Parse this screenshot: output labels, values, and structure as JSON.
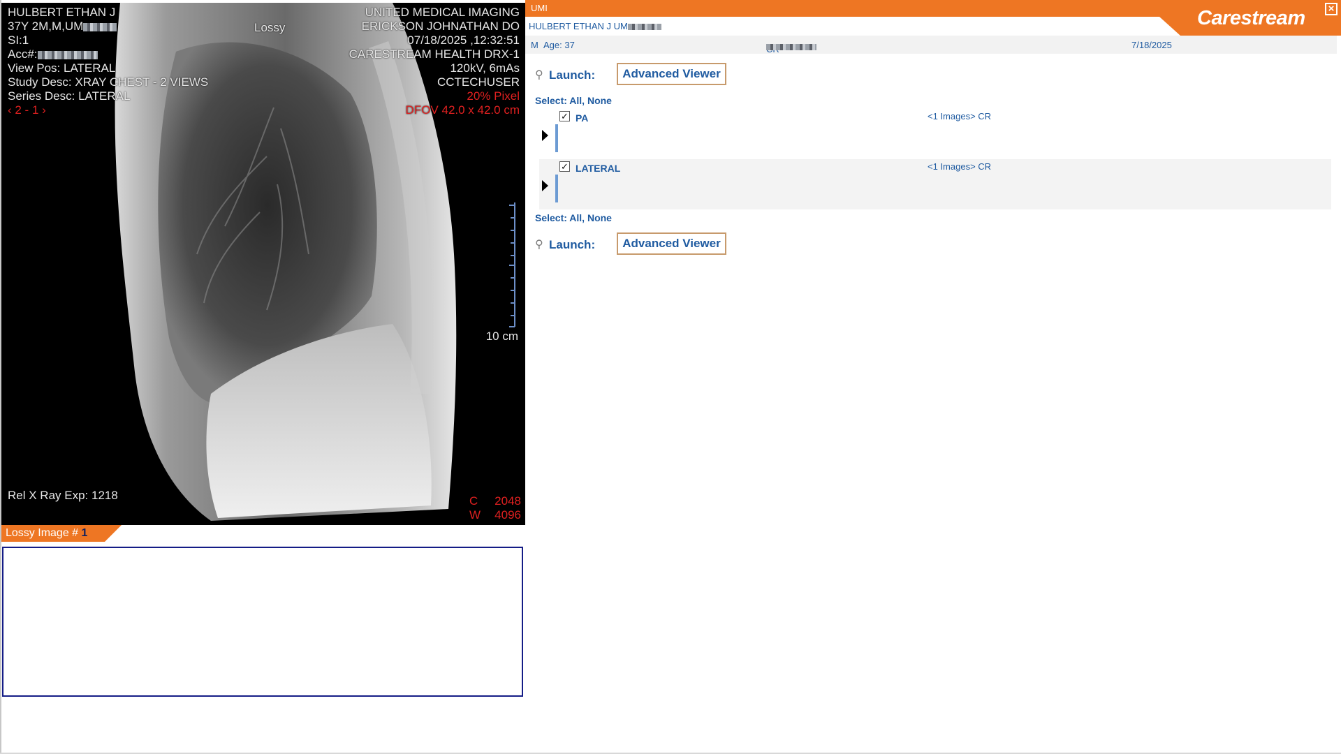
{
  "viewer": {
    "patient_name": "HULBERT ETHAN J",
    "patient_line2": "37Y 2M,M,UM",
    "slice": "SI:1",
    "acc_label": "Acc#:",
    "view_pos": "View Pos: LATERAL",
    "study_desc": "Study Desc: XRAY CHEST - 2 VIEWS",
    "series_desc": "Series Desc: LATERAL",
    "nav": "‹ 2 - 1 ›",
    "lossy_label": "Lossy",
    "institution": "UNITED MEDICAL IMAGING",
    "physician": "ERICKSON JOHNATHAN DO",
    "datetime": "07/18/2025 ,12:32:51",
    "device": "CARESTREAM HEALTH DRX-1",
    "exposure": "120kV, 6mAs",
    "operator": "CCTECHUSER",
    "zoom": "20% Pixel",
    "dfov": "DFOV 42.0 x 42.0 cm",
    "scale_label": "10 cm",
    "rel_exp": "Rel X Ray Exp: 1218",
    "center_label": "C",
    "center_value": "2048",
    "width_label": "W",
    "width_value": "4096"
  },
  "lossy_tab": {
    "label": "Lossy Image # ",
    "number": "1"
  },
  "panel": {
    "org": "UMI",
    "brand": "Carestream",
    "patient_line": "HULBERT ETHAN J UM",
    "sex": "M",
    "age": "Age: 37",
    "modality": "CR",
    "date": "7/18/2025",
    "launch_label": "Launch:",
    "advanced_viewer": "Advanced Viewer",
    "select_label": "Select:",
    "select_all": "All,",
    "select_none": "None",
    "series": [
      {
        "name": "PA",
        "count": "<1 Images> CR",
        "checked": true
      },
      {
        "name": "LATERAL",
        "count": "<1 Images> CR",
        "checked": true
      }
    ]
  },
  "colors": {
    "brand_orange": "#ee7623",
    "link_blue": "#1e5aa0",
    "border_navy": "#141c86"
  },
  "icons": {
    "close": "close-icon",
    "launch": "key-icon",
    "expand": "triangle-right-icon",
    "check": "checkmark-icon"
  }
}
